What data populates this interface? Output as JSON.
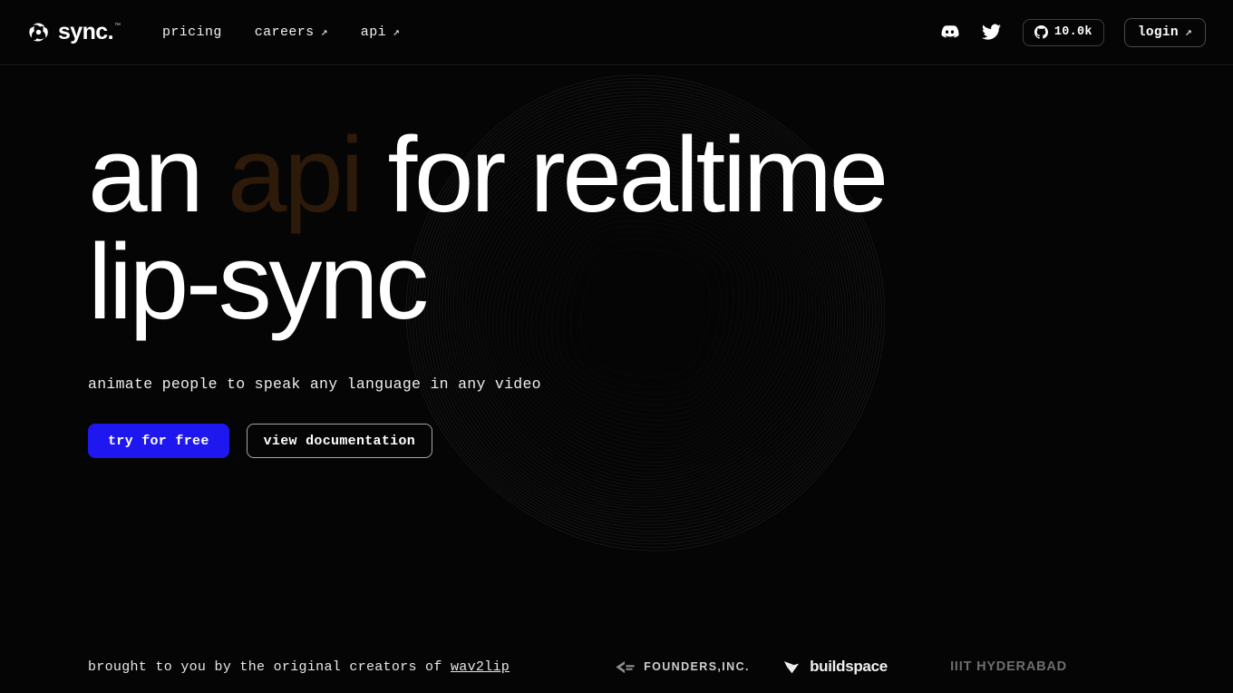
{
  "brand": {
    "name": "sync.",
    "trademark": "™"
  },
  "nav": {
    "items": [
      {
        "label": "pricing",
        "external": false
      },
      {
        "label": "careers",
        "external": true,
        "arrow": "↗"
      },
      {
        "label": "api",
        "external": true,
        "arrow": "↗"
      }
    ]
  },
  "header_right": {
    "discord": "discord-icon",
    "twitter": "twitter-icon",
    "github": {
      "icon": "github-icon",
      "stars": "10.0k"
    },
    "login": {
      "label": "login",
      "arrow": "↗"
    }
  },
  "hero": {
    "headline_line1_a": "an ",
    "headline_line1_faded": "api",
    "headline_line1_b": " for realtime",
    "headline_line2": "lip-sync",
    "subtitle": "animate people to speak any language in any video",
    "primary_cta": "try for free",
    "secondary_cta": "view documentation"
  },
  "bottom": {
    "credit_prefix": "brought to you by the original creators of ",
    "credit_link": "wav2lip",
    "logos": [
      {
        "name": "FOUNDERS,INC."
      },
      {
        "name": "buildspace"
      },
      {
        "name": "IIIT HYDERABAD"
      }
    ]
  },
  "colors": {
    "background": "#050505",
    "accent_blue": "#1f17f0",
    "faded_word": "#2e1a09",
    "text_primary": "#ffffff",
    "border": "#3d3d3d",
    "mesh_line": "#2a2a2a"
  }
}
